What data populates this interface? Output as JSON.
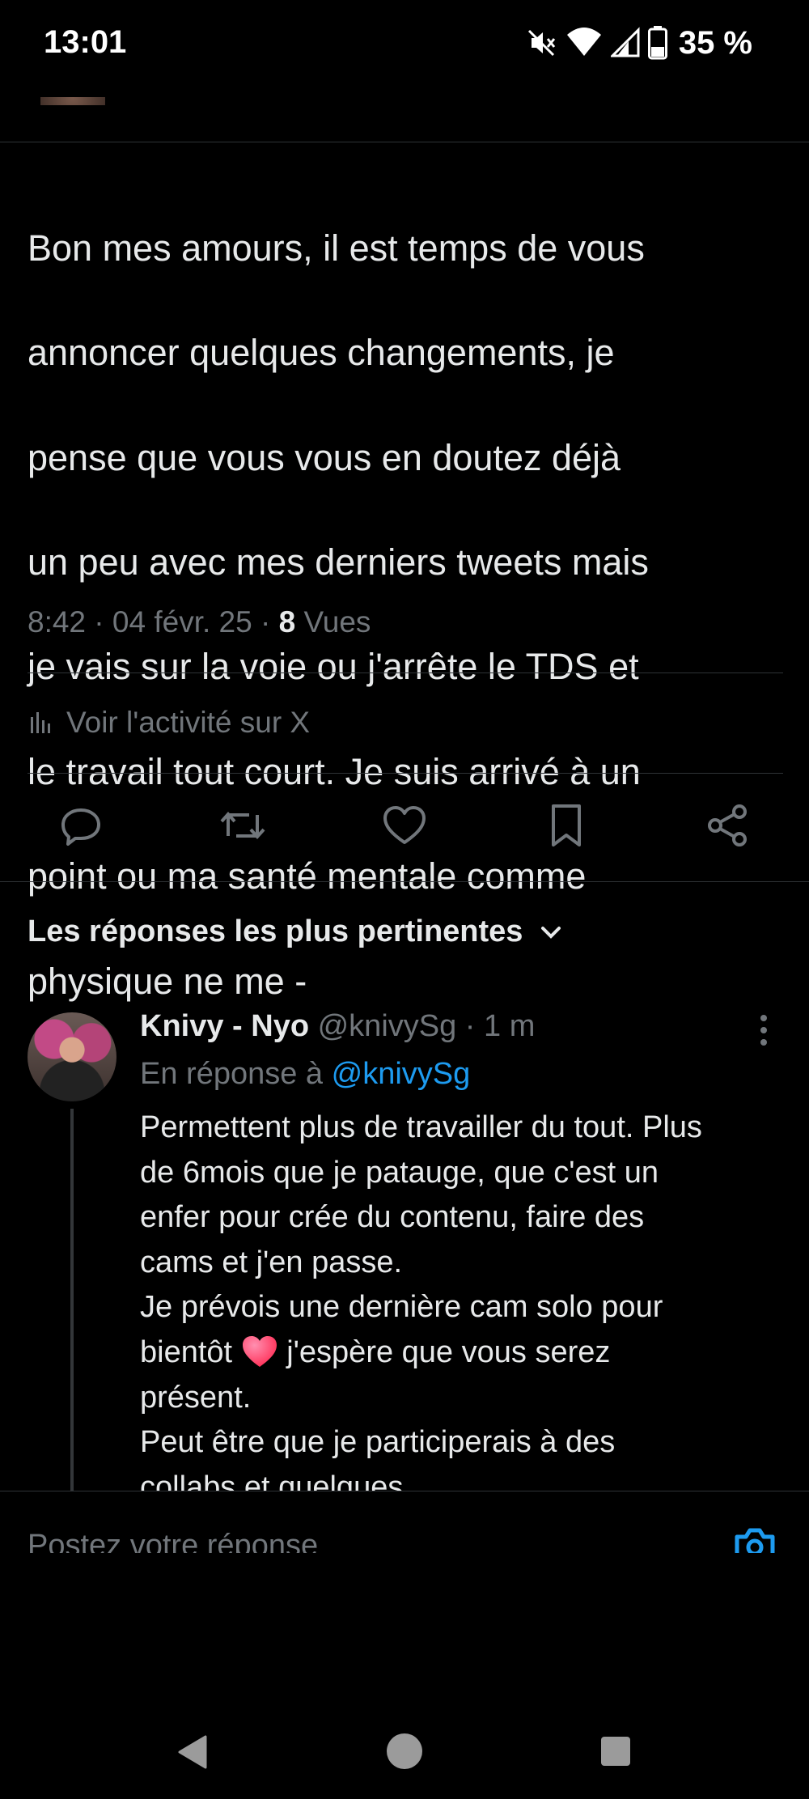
{
  "status_bar": {
    "time": "13:01",
    "battery_percent": "35 %",
    "icons": [
      "mute-icon",
      "wifi-icon",
      "cell-signal-icon",
      "battery-icon"
    ]
  },
  "tweet": {
    "text_lines": [
      "Bon mes amours, il est temps de vous",
      "annoncer quelques changements, je",
      "pense que vous vous en doutez déjà",
      "un peu avec mes derniers tweets mais",
      "je vais sur la voie ou j'arrête le TDS et",
      "le travail tout court. Je suis arrivé à un",
      "point ou ma santé mentale comme",
      "physique ne me -"
    ],
    "time": "8:42",
    "date": "04 févr. 25",
    "views_count": "8",
    "views_label": "Vues",
    "separator": " · "
  },
  "activity": {
    "label": "Voir l'activité sur X"
  },
  "actions": [
    "reply-icon",
    "retweet-icon",
    "like-icon",
    "bookmark-icon",
    "share-icon"
  ],
  "sort": {
    "label": "Les réponses les plus pertinentes"
  },
  "reply": {
    "name": "Knivy - Nyo",
    "handle": "@knivySg",
    "time": "1 m",
    "reply_to_prefix": "En réponse à",
    "reply_to_handle": "@knivySg",
    "lines": [
      "Permettent plus de travailler du tout. Plus",
      "de 6mois que je patauge, que c'est un",
      "enfer pour crée du contenu, faire des",
      "cams et j'en passe.",
      "Je prévois une dernière cam solo pour",
      "bientôt",
      "j'espère que vous serez",
      "présent.",
      "Peut être que je participerais à des",
      "collabs et quelques"
    ]
  },
  "compose": {
    "placeholder": "Postez votre réponse"
  },
  "colors": {
    "background": "#000000",
    "text": "#e7e9ea",
    "muted": "#71767b",
    "link": "#1d9bf0",
    "divider": "#2f3336"
  }
}
